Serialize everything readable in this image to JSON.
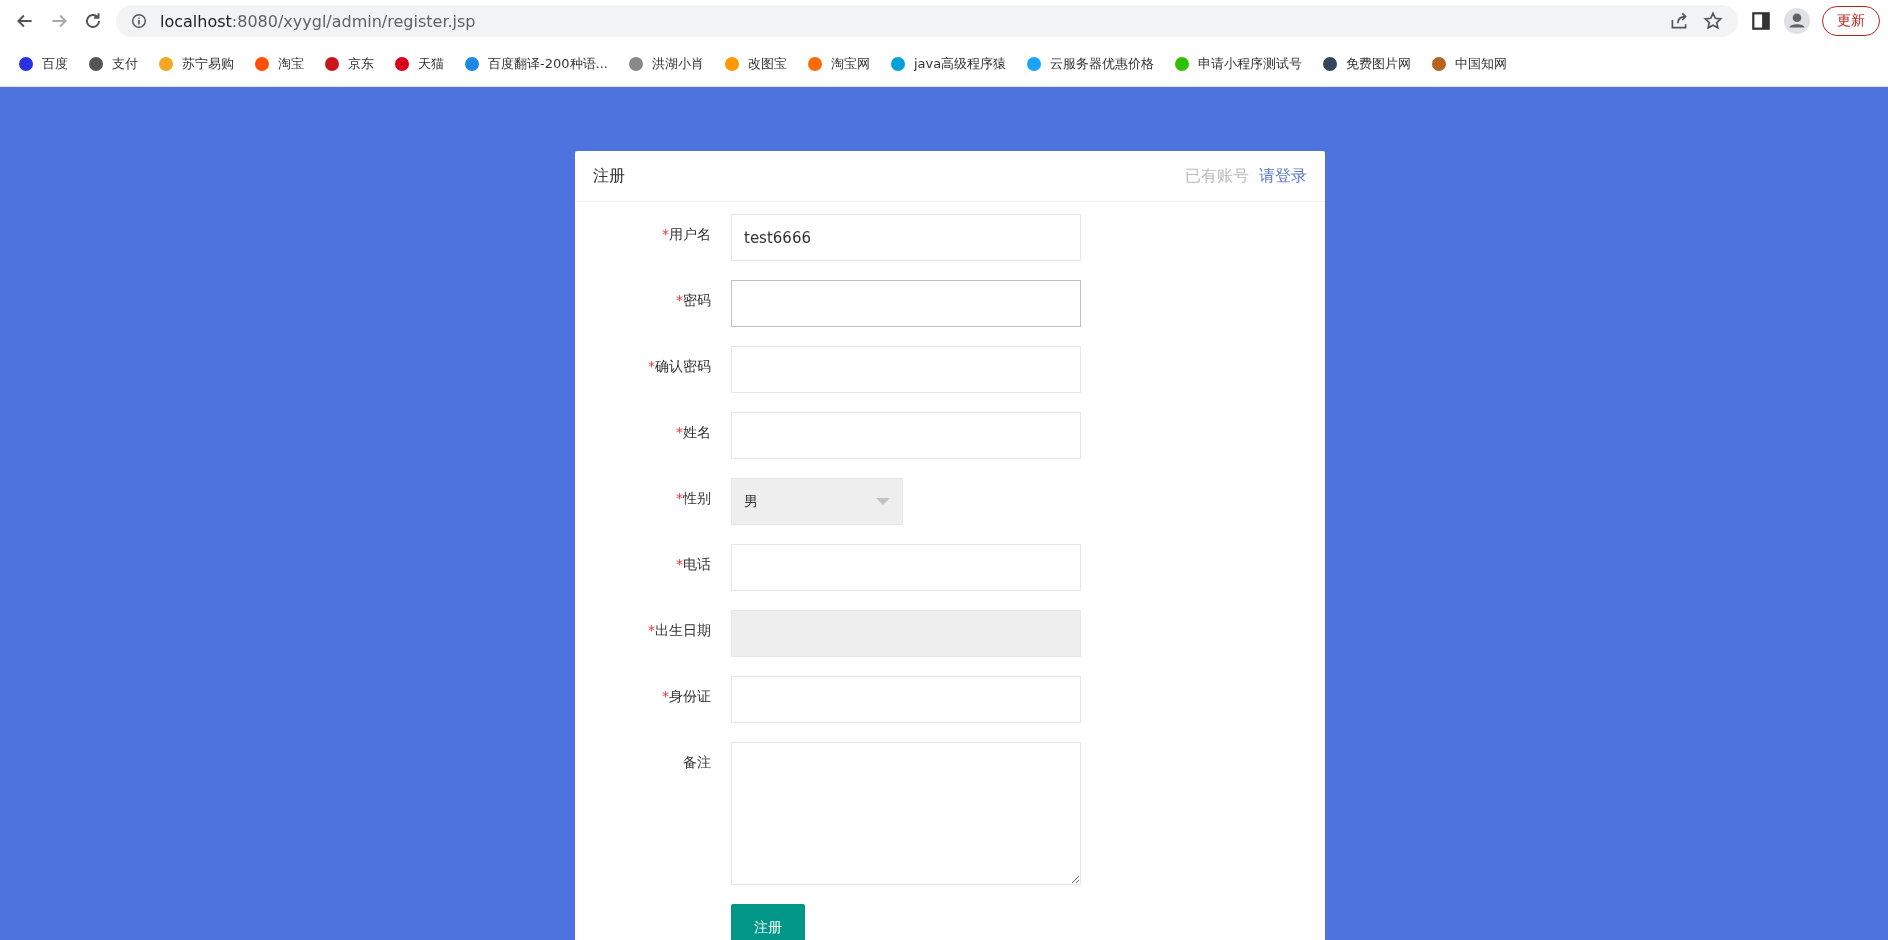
{
  "browser": {
    "url_host": "localhost",
    "url_rest": ":8080/xyygl/admin/register.jsp",
    "update_button": "更新"
  },
  "bookmarks": [
    "百度",
    "支付",
    "苏宁易购",
    "淘宝",
    "京东",
    "天猫",
    "百度翻译-200种语...",
    "洪湖小肖",
    "改图宝",
    "淘宝网",
    "java高级程序猿",
    "云服务器优惠价格",
    "申请小程序测试号",
    "免费图片网",
    "中国知网"
  ],
  "card": {
    "title": "注册",
    "have_account": "已有账号",
    "login_link": "请登录"
  },
  "fields": [
    {
      "kind": "input",
      "required_mark": "*",
      "label": "用户名",
      "value": "test6666",
      "focused": false
    },
    {
      "kind": "input",
      "required_mark": "*",
      "label": "密码",
      "focused": true
    },
    {
      "kind": "input",
      "required_mark": "*",
      "label": "确认密码",
      "focused": false
    },
    {
      "kind": "input",
      "required_mark": "*",
      "label": "姓名",
      "focused": false
    },
    {
      "kind": "select",
      "required_mark": "*",
      "label": "性别",
      "value": "男"
    },
    {
      "kind": "input",
      "required_mark": "*",
      "label": "电话",
      "focused": false
    },
    {
      "kind": "date",
      "required_mark": "*",
      "label": "出生日期"
    },
    {
      "kind": "input",
      "required_mark": "*",
      "label": "身份证",
      "focused": false
    },
    {
      "kind": "textarea",
      "label": "备注"
    }
  ],
  "submit": "注册"
}
